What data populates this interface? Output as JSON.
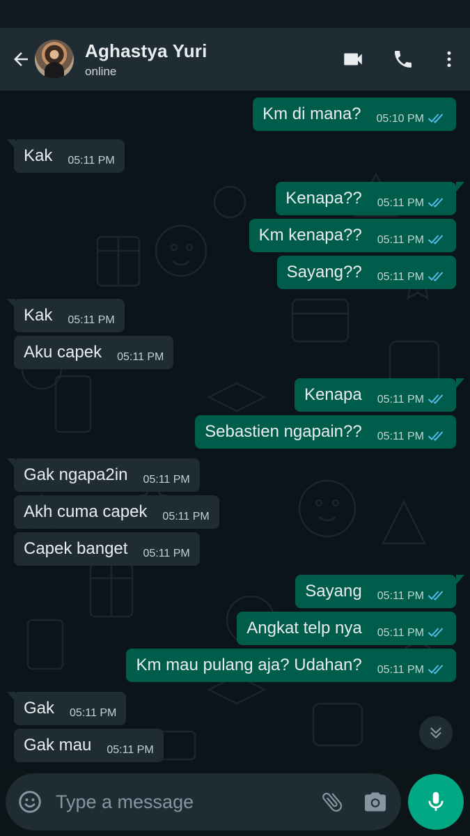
{
  "contact": {
    "name": "Aghastya Yuri",
    "status": "online"
  },
  "icons": {
    "back": "back-arrow-icon",
    "video": "video-call-icon",
    "call": "phone-icon",
    "menu": "more-vert-icon",
    "emoji": "emoji-icon",
    "attach": "paperclip-icon",
    "camera": "camera-icon",
    "mic": "mic-icon",
    "scroll": "double-chevron-down-icon"
  },
  "colors": {
    "header": "#1f2c33",
    "chat_background": "#0b141a",
    "incoming_bubble": "#1f2c33",
    "outgoing_bubble": "#005c4b",
    "read_ticks": "#53bdeb",
    "accent": "#00a884"
  },
  "messages": [
    {
      "dir": "out",
      "text": "Km di mana?",
      "time": "05:10 PM",
      "read": true
    },
    {
      "dir": "in",
      "text": "Kak",
      "time": "05:11 PM"
    },
    {
      "dir": "out",
      "text": "Kenapa??",
      "time": "05:11 PM",
      "read": true
    },
    {
      "dir": "out",
      "text": "Km kenapa??",
      "time": "05:11 PM",
      "read": true
    },
    {
      "dir": "out",
      "text": "Sayang??",
      "time": "05:11 PM",
      "read": true
    },
    {
      "dir": "in",
      "text": "Kak",
      "time": "05:11 PM"
    },
    {
      "dir": "in",
      "text": "Aku capek",
      "time": "05:11 PM"
    },
    {
      "dir": "out",
      "text": "Kenapa",
      "time": "05:11 PM",
      "read": true
    },
    {
      "dir": "out",
      "text": "Sebastien ngapain??",
      "time": "05:11 PM",
      "read": true
    },
    {
      "dir": "in",
      "text": "Gak ngapa2in",
      "time": "05:11 PM"
    },
    {
      "dir": "in",
      "text": "Akh cuma capek",
      "time": "05:11 PM"
    },
    {
      "dir": "in",
      "text": "Capek banget",
      "time": "05:11 PM"
    },
    {
      "dir": "out",
      "text": "Sayang",
      "time": "05:11 PM",
      "read": true
    },
    {
      "dir": "out",
      "text": "Angkat telp nya",
      "time": "05:11 PM",
      "read": true
    },
    {
      "dir": "out",
      "text": "Km mau pulang aja? Udahan?",
      "time": "05:11 PM",
      "read": true
    },
    {
      "dir": "in",
      "text": "Gak",
      "time": "05:11 PM"
    },
    {
      "dir": "in",
      "text": "Gak mau",
      "time": "05:11 PM"
    }
  ],
  "composer": {
    "placeholder": "Type a message",
    "value": ""
  }
}
